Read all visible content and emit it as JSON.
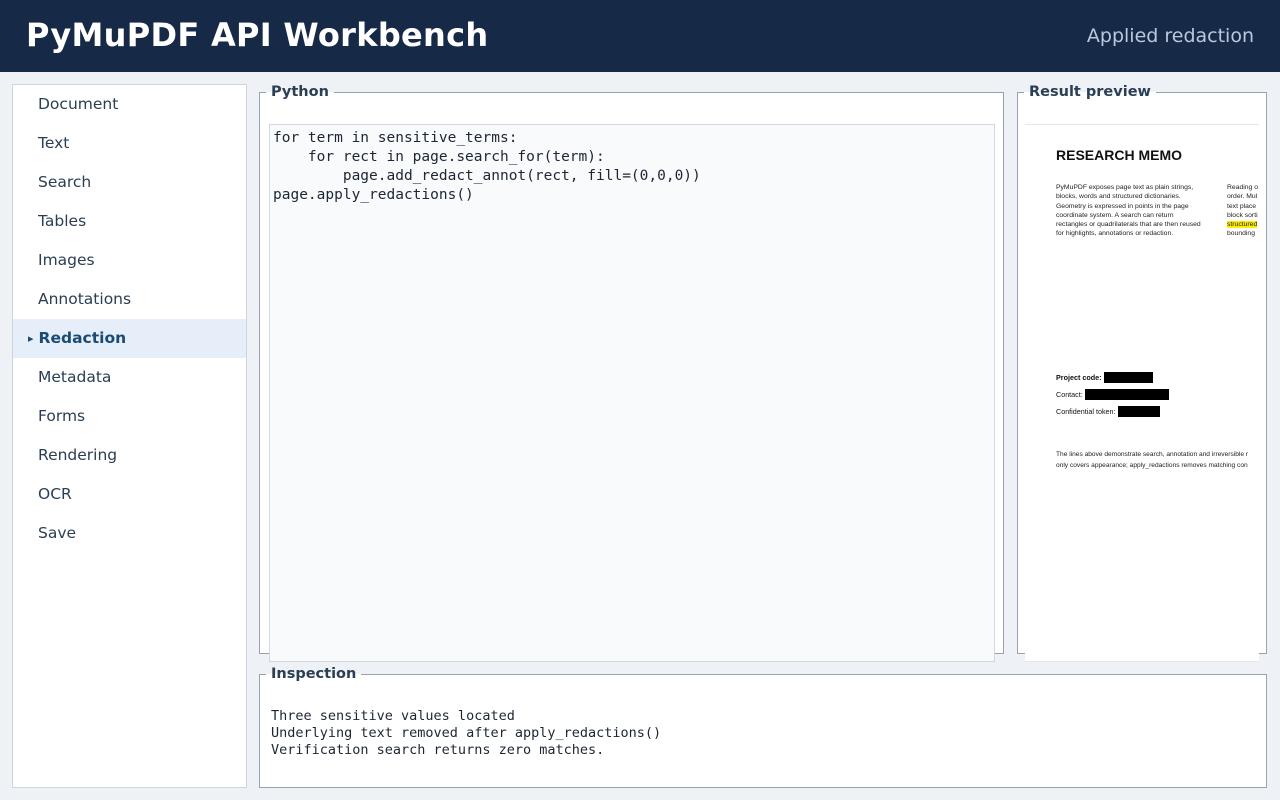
{
  "header": {
    "title": "PyMuPDF API Workbench",
    "status": "Applied redaction"
  },
  "sidebar": {
    "items": [
      {
        "label": "Document"
      },
      {
        "label": "Text"
      },
      {
        "label": "Search"
      },
      {
        "label": "Tables"
      },
      {
        "label": "Images"
      },
      {
        "label": "Annotations"
      },
      {
        "label": "Redaction",
        "active": true
      },
      {
        "label": "Metadata"
      },
      {
        "label": "Forms"
      },
      {
        "label": "Rendering"
      },
      {
        "label": "OCR"
      },
      {
        "label": "Save"
      }
    ],
    "active_marker": "▸"
  },
  "python_panel": {
    "legend": "Python",
    "code": "for term in sensitive_terms:\n    for rect in page.search_for(term):\n        page.add_redact_annot(rect, fill=(0,0,0))\npage.apply_redactions()"
  },
  "preview_panel": {
    "legend": "Result preview",
    "doc": {
      "title": "RESEARCH MEMO",
      "col1_lines": [
        "PyMuPDF exposes page text as plain strings,",
        "blocks, words and structured dictionaries.",
        "Geometry is expressed in points in the page",
        "coordinate system. A search can return",
        "rectangles or quadrilaterals that are then reused",
        "for highlights, annotations or redaction."
      ],
      "col2_lines": [
        "Reading o",
        "order. Mul",
        "text place",
        "block sorti",
        "structured",
        "bounding"
      ],
      "highlight_color": "#ffee00",
      "fields": [
        {
          "label": "Project code:",
          "bold": true,
          "redacted_width": 0.21
        },
        {
          "label": "Contact:",
          "bold": false,
          "redacted_width": 0.36
        },
        {
          "label": "Confidential token:",
          "bold": false,
          "redacted_width": 0.18
        }
      ],
      "footer_lines": [
        "The lines above demonstrate search, annotation and irreversible r",
        "only covers appearance; apply_redactions removes matching con"
      ]
    }
  },
  "inspection_panel": {
    "legend": "Inspection",
    "lines": [
      "Three sensitive values located",
      "Underlying text removed after apply_redactions()",
      "Verification search returns zero matches."
    ]
  },
  "colors": {
    "header_bg": "#162a47",
    "active_nav_bg": "#e6eff9",
    "active_nav_text": "#1b4b73",
    "redaction_fill": "#000000"
  }
}
